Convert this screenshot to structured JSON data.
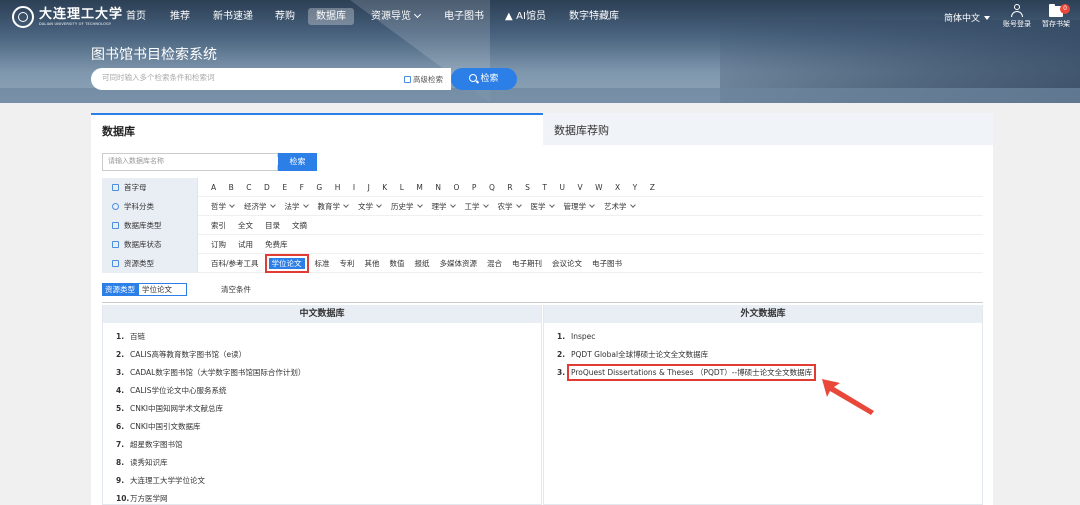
{
  "logo": {
    "name_cn": "大连理工大学",
    "name_en": "DALIAN UNIVERSITY OF TECHNOLOGY"
  },
  "nav": {
    "items": [
      "首页",
      "推荐",
      "新书速递",
      "荐购",
      "数据库",
      "资源导览",
      "电子图书",
      "AI馆员",
      "数字特藏库"
    ],
    "active": "数据库",
    "language": "简体中文",
    "login_label": "账号登录",
    "shelf_label": "暂存书架",
    "shelf_count": "0"
  },
  "hero": {
    "title": "图书馆书目检索系统",
    "search_placeholder": "可同时输入多个检索条件和检索词",
    "advanced_label": "高级检索",
    "search_button": "检索"
  },
  "tabs": {
    "database": "数据库",
    "recommend": "数据库荐购"
  },
  "db_search": {
    "placeholder": "请输入数据库名称",
    "button": "检索"
  },
  "filters": {
    "initial": {
      "label": "首字母",
      "values": [
        "A",
        "B",
        "C",
        "D",
        "E",
        "F",
        "G",
        "H",
        "I",
        "J",
        "K",
        "L",
        "M",
        "N",
        "O",
        "P",
        "Q",
        "R",
        "S",
        "T",
        "U",
        "V",
        "W",
        "X",
        "Y",
        "Z"
      ]
    },
    "subject": {
      "label": "学科分类",
      "values": [
        "哲学",
        "经济学",
        "法学",
        "教育学",
        "文学",
        "历史学",
        "理学",
        "工学",
        "农学",
        "医学",
        "管理学",
        "艺术学"
      ]
    },
    "db_type": {
      "label": "数据库类型",
      "values": [
        "索引",
        "全文",
        "目录",
        "文摘"
      ]
    },
    "db_status": {
      "label": "数据库状态",
      "values": [
        "订购",
        "试用",
        "免费库"
      ]
    },
    "resource_type": {
      "label": "资源类型",
      "values": [
        "百科/参考工具",
        "学位论文",
        "标准",
        "专利",
        "其他",
        "数值",
        "报纸",
        "多媒体资源",
        "混合",
        "电子期刊",
        "会议论文",
        "电子图书"
      ],
      "selected": "学位论文"
    }
  },
  "condition": {
    "tag": "资源类型",
    "value": "学位论文",
    "clear": "清空条件"
  },
  "chinese_db": {
    "title": "中文数据库",
    "items": [
      "百链",
      "CALIS高等教育数字图书馆（e读）",
      "CADAL数字图书馆（大学数字图书馆国际合作计划）",
      "CALIS学位论文中心服务系统",
      "CNKI中国知网学术文献总库",
      "CNKI中国引文数据库",
      "超星数字图书馆",
      "读秀知识库",
      "大连理工大学学位论文",
      "万方医学网"
    ]
  },
  "foreign_db": {
    "title": "外文数据库",
    "items": [
      "Inspec",
      "PQDT Global全球博硕士论文全文数据库",
      "ProQuest Dissertations & Theses （PQDT）--博硕士论文全文数据库"
    ],
    "highlighted": 2
  },
  "colors": {
    "accent": "#2d7fe8",
    "highlight": "#e23b34",
    "label_bg": "#e9eef5"
  }
}
